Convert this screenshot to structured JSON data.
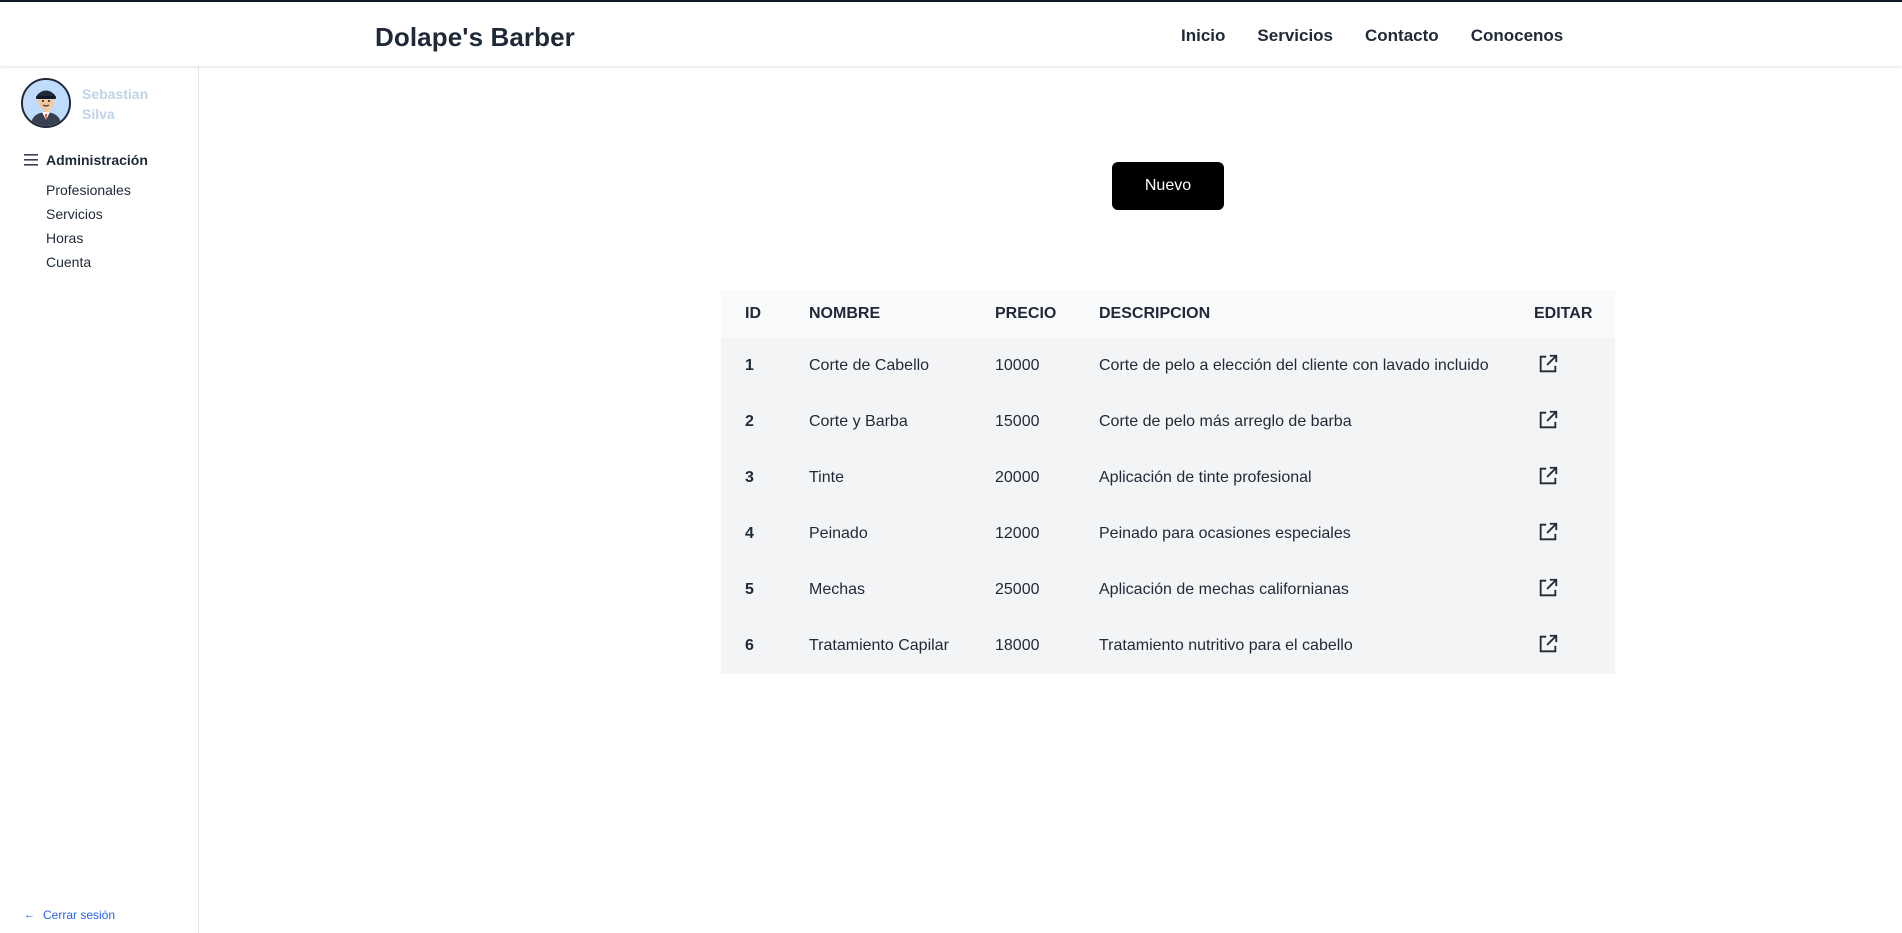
{
  "header": {
    "brand": "Dolape's Barber",
    "nav": [
      "Inicio",
      "Servicios",
      "Contacto",
      "Conocenos"
    ]
  },
  "sidebar": {
    "user_name": "Sebastian Silva",
    "section_label": "Administración",
    "items": [
      "Profesionales",
      "Servicios",
      "Horas",
      "Cuenta"
    ],
    "logout_label": "Cerrar sesión"
  },
  "main": {
    "new_button": "Nuevo",
    "table": {
      "headers": [
        "ID",
        "NOMBRE",
        "PRECIO",
        "DESCRIPCION",
        "EDITAR"
      ],
      "rows": [
        {
          "id": "1",
          "nombre": "Corte de Cabello",
          "precio": "10000",
          "descripcion": "Corte de pelo a elección del cliente con lavado incluido"
        },
        {
          "id": "2",
          "nombre": "Corte y Barba",
          "precio": "15000",
          "descripcion": "Corte de pelo más arreglo de barba"
        },
        {
          "id": "3",
          "nombre": "Tinte",
          "precio": "20000",
          "descripcion": "Aplicación de tinte profesional"
        },
        {
          "id": "4",
          "nombre": "Peinado",
          "precio": "12000",
          "descripcion": "Peinado para ocasiones especiales"
        },
        {
          "id": "5",
          "nombre": "Mechas",
          "precio": "25000",
          "descripcion": "Aplicación de mechas californianas"
        },
        {
          "id": "6",
          "nombre": "Tratamiento Capilar",
          "precio": "18000",
          "descripcion": "Tratamiento nutritivo para el cabello"
        }
      ],
      "edit_icon": "external-link-icon"
    }
  },
  "colors": {
    "text_dark": "#1f2937",
    "username": "#bfd3e8",
    "link_blue": "#2563eb",
    "button_bg": "#000000",
    "table_header_bg": "#f9fafb",
    "table_row_bg": "#f3f4f6"
  }
}
